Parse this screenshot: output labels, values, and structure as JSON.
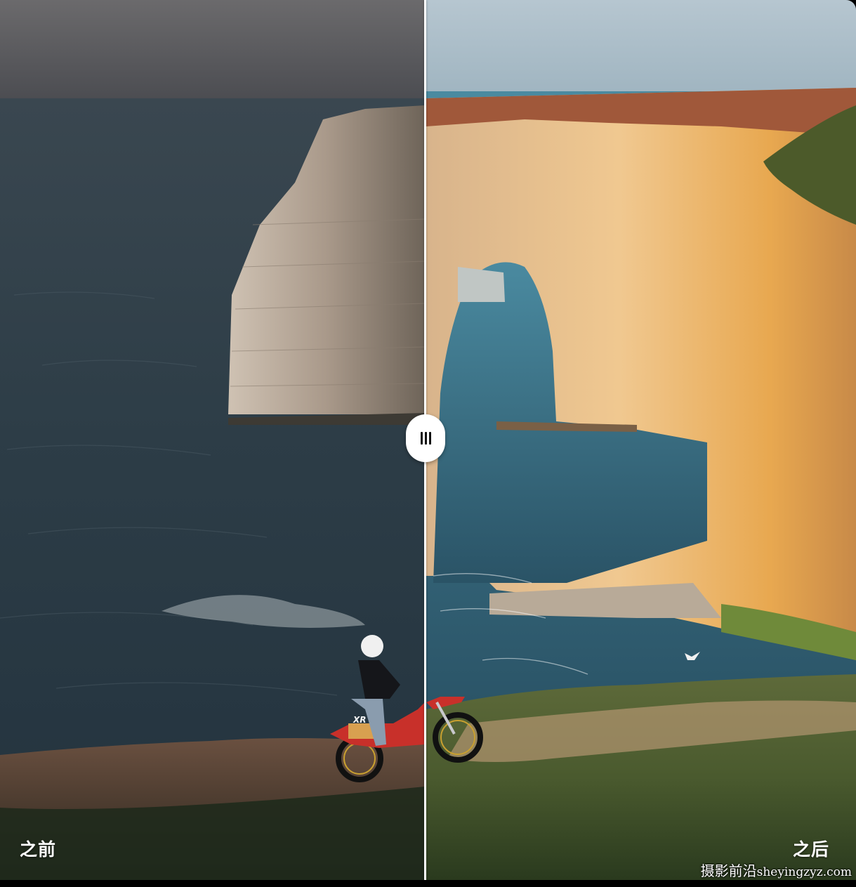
{
  "compare": {
    "before_label": "之前",
    "after_label": "之后",
    "handle_icon": "vertical-grip-icon"
  },
  "watermark": {
    "cn": "摄影前沿",
    "en": "sheyingzyz.com"
  },
  "motorcycle": {
    "badge": "XR"
  },
  "colors": {
    "divider": "#ffffff",
    "label_text": "#ffffff",
    "before_sea": "#2a3a44",
    "after_cliff": "#e8b070"
  }
}
